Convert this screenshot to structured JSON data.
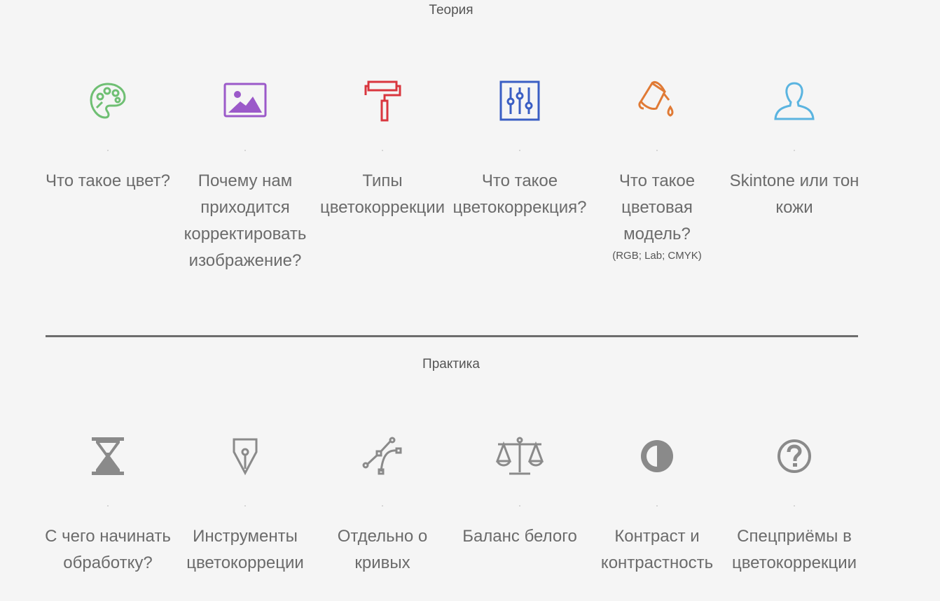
{
  "theory": {
    "title": "Теория",
    "items": [
      {
        "label": "Что такое цвет?",
        "icon": "palette-icon",
        "color": "#6fbf73"
      },
      {
        "label": "Почему нам приходится корректировать изображение?",
        "icon": "image-icon",
        "color": "#9b59c9"
      },
      {
        "label": "Типы цветокоррекции",
        "icon": "paint-roller-icon",
        "color": "#d9363e"
      },
      {
        "label": "Что такое цветокоррекция?",
        "icon": "sliders-icon",
        "color": "#3a5ec4"
      },
      {
        "label": "Что такое цветовая модель?",
        "note": "(RGB; Lab; CMYK)",
        "icon": "paint-bucket-icon",
        "color": "#e07a35"
      },
      {
        "label": "Skintone или тон кожи",
        "icon": "user-icon",
        "color": "#5ab4e0"
      }
    ]
  },
  "practice": {
    "title": "Практика",
    "items": [
      {
        "label": "С чего начинать обработку?",
        "icon": "hourglass-icon",
        "color": "#8a8a8a"
      },
      {
        "label": "Инструменты цветокорреции",
        "icon": "pen-nib-icon",
        "color": "#8a8a8a"
      },
      {
        "label": "Отдельно о кривых",
        "icon": "bezier-curve-icon",
        "color": "#8a8a8a"
      },
      {
        "label": "Баланс белого",
        "icon": "scales-icon",
        "color": "#8a8a8a"
      },
      {
        "label": "Контраст и контрастность",
        "icon": "contrast-icon",
        "color": "#8a8a8a"
      },
      {
        "label": "Спецприёмы в цветокоррекции",
        "icon": "question-icon",
        "color": "#8a8a8a"
      }
    ]
  }
}
